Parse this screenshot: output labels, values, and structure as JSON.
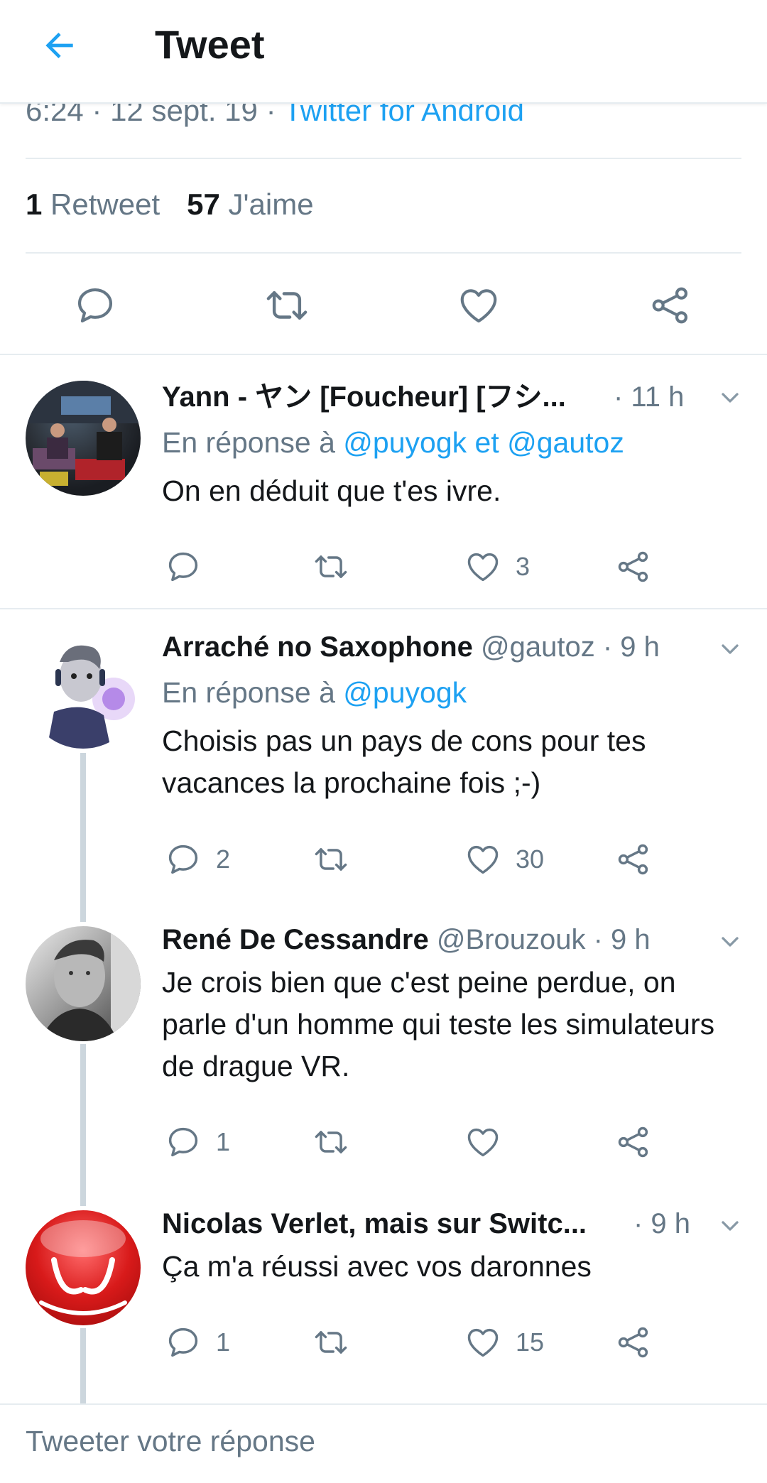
{
  "header": {
    "title": "Tweet"
  },
  "tweet": {
    "meta_time": "6:24 · 12 sept. 19 · ",
    "meta_source": "Twitter for Android",
    "retweet_count": "1",
    "retweet_label": "Retweet",
    "like_count": "57",
    "like_label": "J'aime"
  },
  "replies": [
    {
      "name": "Yann - ヤン [Foucheur] [フシ...",
      "handle": "",
      "time": "· 11 h",
      "reply_prefix": "En réponse à ",
      "reply_to": "@puyogk et @gautoz",
      "text": "On en déduit que t'es ivre.",
      "replies": "",
      "retweets": "",
      "likes": "3"
    },
    {
      "name": "Arraché no Saxophone",
      "handle": "@gautoz",
      "time": "· 9 h",
      "reply_prefix": "En réponse à ",
      "reply_to": "@puyogk",
      "text": "Choisis pas un pays de cons pour tes vacances la prochaine fois ;-)",
      "replies": "2",
      "retweets": "",
      "likes": "30"
    },
    {
      "name": "René De Cessandre",
      "handle": "@Brouzouk",
      "time": "· 9 h",
      "text": "Je crois bien que c'est peine perdue, on parle d'un homme qui teste les simulateurs de drague VR.",
      "replies": "1",
      "retweets": "",
      "likes": ""
    },
    {
      "name": "Nicolas Verlet, mais sur Switc...",
      "handle": "",
      "time": "· 9 h",
      "text": "Ça m'a réussi avec vos daronnes",
      "replies": "1",
      "retweets": "",
      "likes": "15"
    }
  ],
  "compose": {
    "placeholder": "Tweeter votre réponse"
  },
  "colors": {
    "accent": "#1da1f2",
    "text": "#14171a",
    "secondary": "#657786",
    "border": "#e6ecf0",
    "thread": "#ccd6dd"
  },
  "icons": [
    "back-arrow-icon",
    "reply-icon",
    "retweet-icon",
    "like-icon",
    "share-icon",
    "chevron-down-icon"
  ]
}
